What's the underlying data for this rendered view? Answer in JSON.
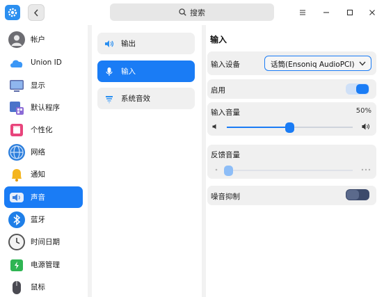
{
  "titlebar": {
    "search_placeholder": "搜索"
  },
  "sidebar": {
    "items": [
      {
        "label": "帐户",
        "icon": "account-icon"
      },
      {
        "label": "Union ID",
        "icon": "cloud-icon"
      },
      {
        "label": "显示",
        "icon": "display-icon"
      },
      {
        "label": "默认程序",
        "icon": "default-apps-icon"
      },
      {
        "label": "个性化",
        "icon": "personalization-icon"
      },
      {
        "label": "网络",
        "icon": "network-icon"
      },
      {
        "label": "通知",
        "icon": "bell-icon"
      },
      {
        "label": "声音",
        "icon": "speaker-icon",
        "active": true
      },
      {
        "label": "蓝牙",
        "icon": "bluetooth-icon"
      },
      {
        "label": "时间日期",
        "icon": "clock-icon"
      },
      {
        "label": "电源管理",
        "icon": "battery-icon"
      },
      {
        "label": "鼠标",
        "icon": "mouse-icon"
      }
    ]
  },
  "subnav": {
    "items": [
      {
        "label": "输出",
        "icon": "speaker-output-icon"
      },
      {
        "label": "输入",
        "icon": "microphone-icon",
        "active": true
      },
      {
        "label": "系统音效",
        "icon": "sound-effects-icon"
      }
    ]
  },
  "main": {
    "title": "输入",
    "input_device_label": "输入设备",
    "input_device_value": "话筒(Ensoniq AudioPCI)",
    "enable_label": "启用",
    "enable_on": true,
    "input_volume_label": "输入音量",
    "input_volume_percent": "50%",
    "input_volume_value": 0.5,
    "feedback_volume_label": "反馈音量",
    "feedback_volume_value": 0.0,
    "noise_suppression_label": "噪音抑制",
    "noise_suppression_on": false
  },
  "colors": {
    "accent": "#1a7cf5",
    "toggle_off": "#3c4a6b"
  }
}
